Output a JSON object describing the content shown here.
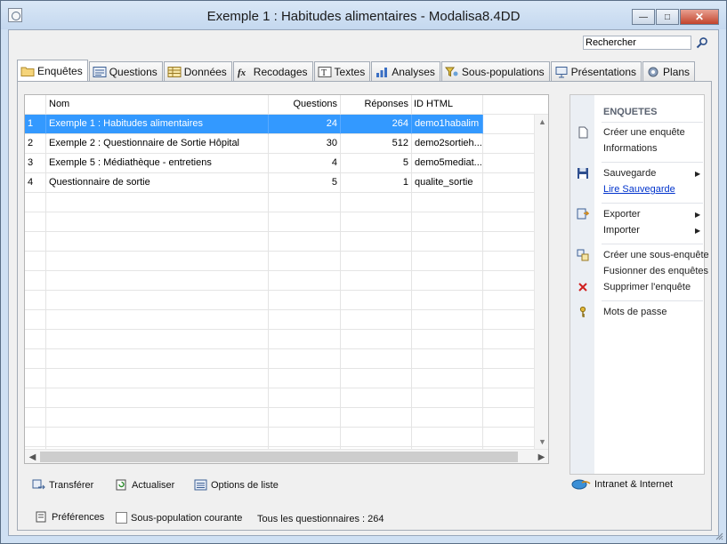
{
  "window": {
    "title": "Exemple 1 : Habitudes alimentaires - Modalisa8.4DD",
    "controls": {
      "minimize": "—",
      "maximize": "□",
      "close": "✕"
    }
  },
  "search": {
    "value": "Rechercher"
  },
  "tabs": [
    {
      "label": "Enquêtes",
      "icon": "folder-icon",
      "active": true
    },
    {
      "label": "Questions",
      "icon": "questions-icon",
      "active": false
    },
    {
      "label": "Données",
      "icon": "table-icon",
      "active": false
    },
    {
      "label": "Recodages",
      "icon": "fx-icon",
      "active": false
    },
    {
      "label": "Textes",
      "icon": "text-icon",
      "active": false
    },
    {
      "label": "Analyses",
      "icon": "bar-chart-icon",
      "active": false
    },
    {
      "label": "Sous-populations",
      "icon": "filter-icon",
      "active": false
    },
    {
      "label": "Présentations",
      "icon": "presentation-icon",
      "active": false
    },
    {
      "label": "Plans",
      "icon": "gear-icon",
      "active": false
    }
  ],
  "table": {
    "columns": [
      "",
      "Nom",
      "Questions",
      "Réponses",
      "ID HTML",
      ""
    ],
    "rows": [
      {
        "num": "1",
        "nom": "Exemple 1 : Habitudes alimentaires",
        "questions": "24",
        "reponses": "264",
        "id": "demo1habalim",
        "selected": true
      },
      {
        "num": "2",
        "nom": "Exemple 2 : Questionnaire de Sortie  Hôpital",
        "questions": "30",
        "reponses": "512",
        "id": "demo2sortieh...",
        "selected": false
      },
      {
        "num": "3",
        "nom": "Exemple 5 : Médiathèque - entretiens",
        "questions": "4",
        "reponses": "5",
        "id": "demo5mediat...",
        "selected": false
      },
      {
        "num": "4",
        "nom": "Questionnaire de sortie",
        "questions": "5",
        "reponses": "1",
        "id": "qualite_sortie",
        "selected": false
      }
    ]
  },
  "sidepanel": {
    "title": "ENQUETES",
    "items": {
      "create": "Créer une enquête",
      "info": "Informations",
      "save": "Sauvegarde",
      "read_save": "Lire Sauvegarde",
      "export": "Exporter",
      "import": "Importer",
      "create_sub": "Créer une sous-enquête",
      "merge": "Fusionner des enquêtes",
      "delete": "Supprimer l'enquête",
      "passwords": "Mots de passe"
    }
  },
  "bottom": {
    "transfer": "Transférer",
    "refresh": "Actualiser",
    "list_options": "Options de liste",
    "intranet": "Intranet & Internet",
    "preferences": "Préférences",
    "subpop_checkbox": "Sous-population courante",
    "status": "Tous les questionnaires : 264"
  },
  "colors": {
    "selection": "#3399ff",
    "link": "#0033cc",
    "window_frame": "#cfe0f3"
  }
}
